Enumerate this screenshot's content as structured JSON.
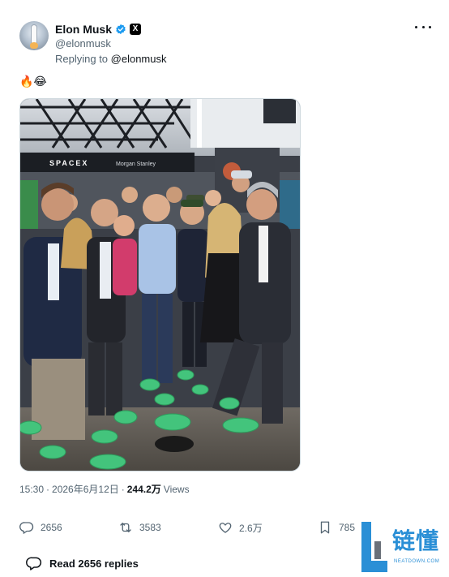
{
  "author": {
    "display_name": "Elon Musk",
    "handle": "@elonmusk",
    "replying_label": "Replying to ",
    "replying_to": "@elonmusk",
    "x_badge": "X"
  },
  "tweet": {
    "text": "🔥😂"
  },
  "media": {
    "storefront_sign_1": "SPACEX",
    "storefront_sign_2": "Morgan Stanley"
  },
  "meta": {
    "time": "15:30",
    "separator": "·",
    "date": "2026年6月12日",
    "views_count": "244.2万",
    "views_label": "Views"
  },
  "actions": {
    "replies": "2656",
    "reposts": "3583",
    "likes": "2.6万",
    "bookmarks": "785"
  },
  "read_replies": {
    "label": "Read 2656 replies"
  },
  "watermark": {
    "title": "链懂",
    "subtitle": "NEATDOWN.COM"
  },
  "colors": {
    "verified": "#1d9bf0",
    "muted": "#536471",
    "text": "#0f1419",
    "watermark": "#2a8fd6"
  }
}
